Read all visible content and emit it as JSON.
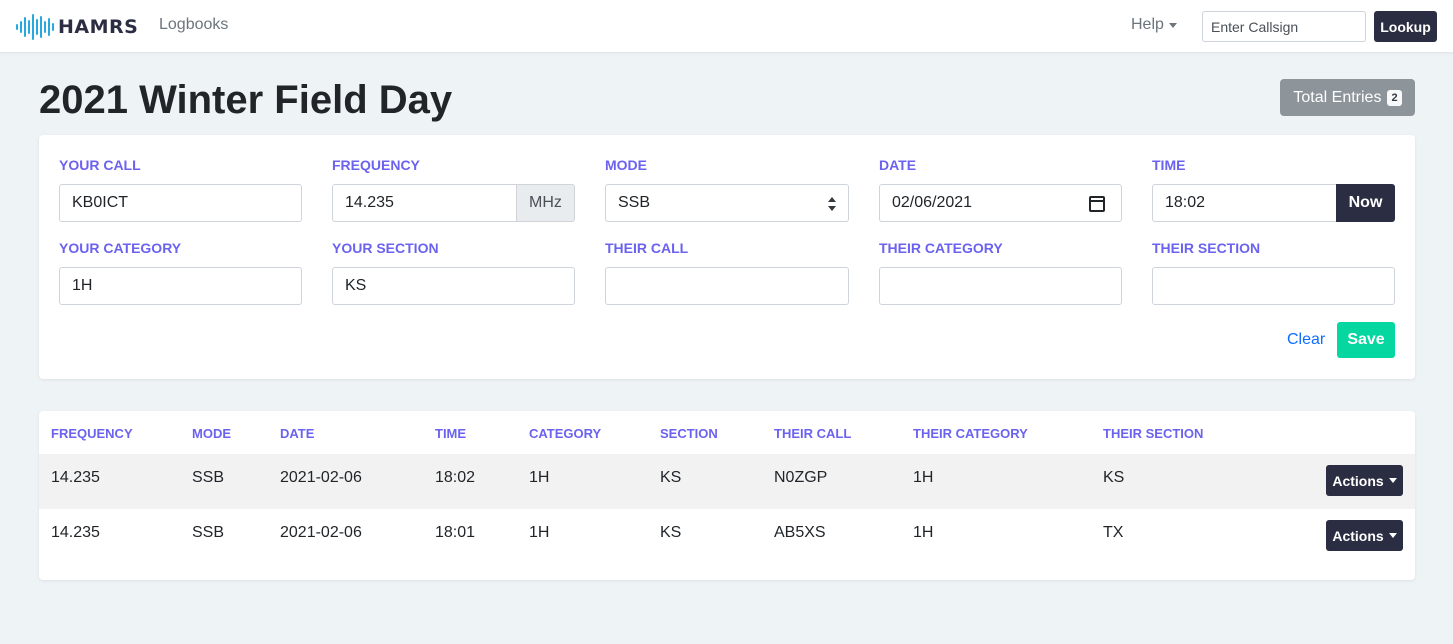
{
  "navbar": {
    "brand": "HAMRS",
    "logbooks_link": "Logbooks",
    "help_label": "Help",
    "search_placeholder": "Enter Callsign",
    "lookup_label": "Lookup"
  },
  "page": {
    "title": "2021 Winter Field Day",
    "total_entries_label": "Total Entries",
    "total_entries_count": "2"
  },
  "form": {
    "your_call": {
      "label": "YOUR CALL",
      "value": "KB0ICT"
    },
    "frequency": {
      "label": "FREQUENCY",
      "value": "14.235",
      "unit": "MHz"
    },
    "mode": {
      "label": "MODE",
      "value": "SSB"
    },
    "date": {
      "label": "DATE",
      "value": "02/06/2021"
    },
    "time": {
      "label": "TIME",
      "value": "18:02",
      "now_label": "Now"
    },
    "your_category": {
      "label": "YOUR CATEGORY",
      "value": "1H"
    },
    "your_section": {
      "label": "YOUR SECTION",
      "value": "KS"
    },
    "their_call": {
      "label": "THEIR CALL",
      "value": ""
    },
    "their_category": {
      "label": "THEIR CATEGORY",
      "value": ""
    },
    "their_section": {
      "label": "THEIR SECTION",
      "value": ""
    },
    "clear_label": "Clear",
    "save_label": "Save"
  },
  "table": {
    "headers": [
      "FREQUENCY",
      "MODE",
      "DATE",
      "TIME",
      "CATEGORY",
      "SECTION",
      "THEIR CALL",
      "THEIR CATEGORY",
      "THEIR SECTION"
    ],
    "actions_label": "Actions",
    "rows": [
      [
        "14.235",
        "SSB",
        "2021-02-06",
        "18:02",
        "1H",
        "KS",
        "N0ZGP",
        "1H",
        "KS"
      ],
      [
        "14.235",
        "SSB",
        "2021-02-06",
        "18:01",
        "1H",
        "KS",
        "AB5XS",
        "1H",
        "TX"
      ]
    ]
  },
  "colors": {
    "accent": "#6b62f0",
    "dark": "#2b2d42",
    "success": "#06d6a0",
    "link": "#0d6efd"
  }
}
